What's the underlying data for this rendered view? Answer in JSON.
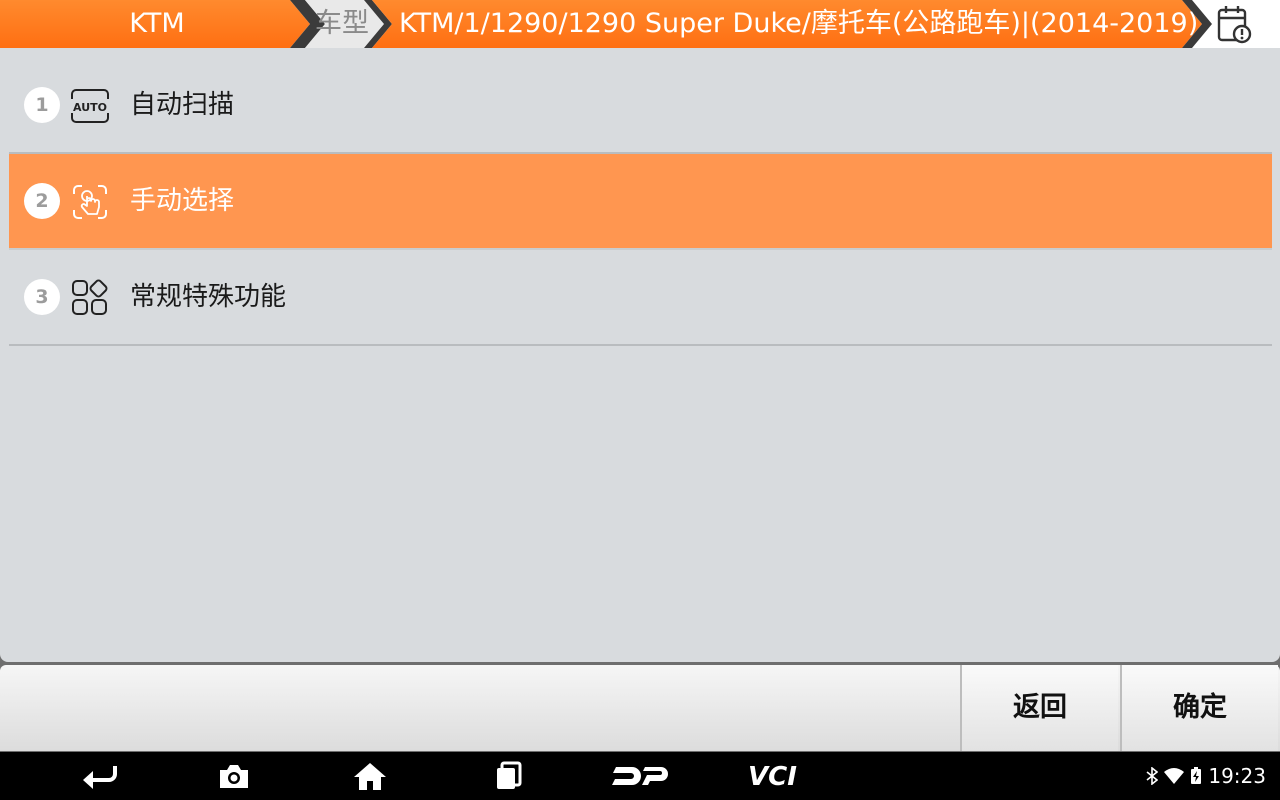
{
  "breadcrumb": {
    "brand": "KTM",
    "model_tab": "车型",
    "path": "KTM/1/1290/1290 Super Duke/摩托车(公路跑车)|(2014-2019)"
  },
  "menu": {
    "items": [
      {
        "number": "1",
        "label": "自动扫描",
        "icon": "auto-scan-icon",
        "selected": false
      },
      {
        "number": "2",
        "label": "手动选择",
        "icon": "hand-touch-icon",
        "selected": true
      },
      {
        "number": "3",
        "label": "常规特殊功能",
        "icon": "apps-grid-icon",
        "selected": false
      }
    ]
  },
  "footer": {
    "back_label": "返回",
    "confirm_label": "确定"
  },
  "status_bar": {
    "time": "19:23"
  },
  "colors": {
    "accent_orange": "#ff7a1a",
    "selected_row": "#ff9650",
    "panel_bg": "#d8dbde"
  }
}
